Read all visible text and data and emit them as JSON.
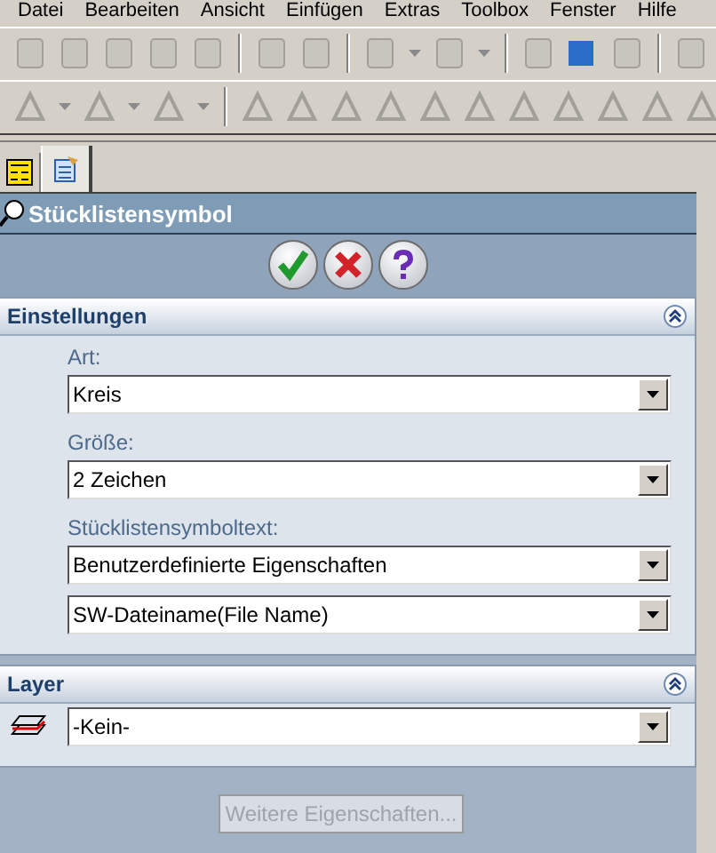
{
  "menu": [
    "Datei",
    "Bearbeiten",
    "Ansicht",
    "Einfügen",
    "Extras",
    "Toolbox",
    "Fenster",
    "Hilfe"
  ],
  "tabs": [
    {
      "selected": false
    },
    {
      "selected": true
    }
  ],
  "panel": {
    "title": "Stücklistensymbol"
  },
  "sections": [
    {
      "title": "Einstellungen",
      "expanded": true,
      "fields": [
        {
          "label": "Art:",
          "value": "Kreis"
        },
        {
          "label": "Größe:",
          "value": "2 Zeichen"
        },
        {
          "label": "Stücklistensymboltext:",
          "value": "Benutzerdefinierte Eigenschaften"
        },
        {
          "value": "SW-Dateiname(File Name)"
        }
      ]
    },
    {
      "title": "Layer",
      "expanded": true,
      "fields": [
        {
          "value": "-Kein-",
          "kind": "layer"
        }
      ]
    }
  ],
  "more_button": {
    "label": "Weitere Eigenschaften...",
    "disabled": true
  }
}
